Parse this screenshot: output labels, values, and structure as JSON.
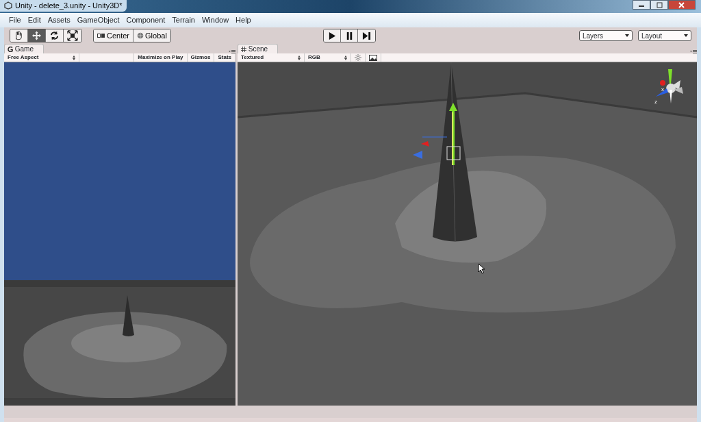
{
  "window": {
    "title": "Unity - delete_3.unity - Unity3D*"
  },
  "menu": [
    "File",
    "Edit",
    "Assets",
    "GameObject",
    "Component",
    "Terrain",
    "Window",
    "Help"
  ],
  "tools": [
    {
      "kind": "hand",
      "selected": false
    },
    {
      "kind": "move",
      "selected": true
    },
    {
      "kind": "rotate",
      "selected": false
    },
    {
      "kind": "scale",
      "selected": false
    }
  ],
  "pivot_buttons": [
    {
      "kind": "center",
      "label": "Center"
    },
    {
      "kind": "global",
      "label": "Global"
    }
  ],
  "playback": [
    {
      "kind": "play"
    },
    {
      "kind": "pause"
    },
    {
      "kind": "step"
    }
  ],
  "dropdowns": [
    "Layers",
    "Layout"
  ],
  "game_panel": {
    "tab": "Game",
    "aspect": "Free Aspect",
    "options": [
      "Maximize on Play",
      "Gizmos",
      "Stats"
    ]
  },
  "scene_panel": {
    "tab": "Scene",
    "draw_mode": "Textured",
    "render_mode": "RGB",
    "axis_labels": [
      "x",
      "z"
    ]
  }
}
